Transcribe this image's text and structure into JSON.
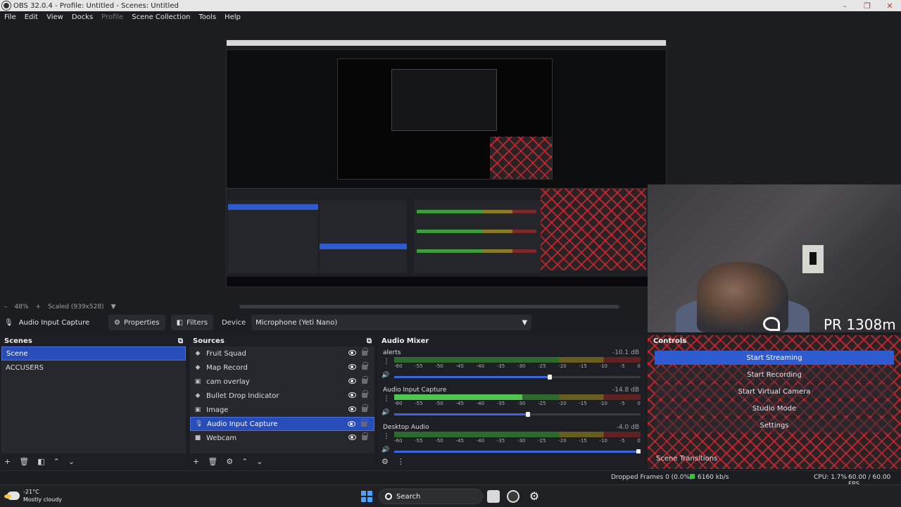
{
  "window": {
    "title": "OBS 32.0.4 - Profile: Untitled - Scenes: Untitled",
    "controls": [
      "–",
      "❐",
      "✕"
    ]
  },
  "menu": {
    "items": [
      "File",
      "Edit",
      "View",
      "Docks",
      "Profile",
      "Scene Collection",
      "Tools",
      "Help"
    ]
  },
  "preview": {
    "zoom": "48%",
    "scaled": "Scaled (939x528)",
    "overlay_text": "PR 1308m"
  },
  "context": {
    "source_name": "Audio Input Capture",
    "properties_label": "Properties",
    "filters_label": "Filters",
    "device_label": "Device",
    "device_value": "Microphone (Yeti Nano)"
  },
  "scenes": {
    "title": "Scenes",
    "items": [
      {
        "label": "Scene",
        "selected": true
      },
      {
        "label": "ACCUSERS",
        "selected": false
      }
    ]
  },
  "sources": {
    "title": "Sources",
    "items": [
      {
        "label": "Fruit Squad",
        "icon": "game-capture-icon"
      },
      {
        "label": "Map Record",
        "icon": "game-capture-icon"
      },
      {
        "label": "cam overlay",
        "icon": "image-icon"
      },
      {
        "label": "Bullet Drop Indicator",
        "icon": "game-capture-icon"
      },
      {
        "label": "Image",
        "icon": "image-icon"
      },
      {
        "label": "Audio Input Capture",
        "icon": "microphone-icon",
        "selected": true
      },
      {
        "label": "Webcam",
        "icon": "camera-icon"
      }
    ]
  },
  "mixer": {
    "title": "Audio Mixer",
    "ticks": [
      "-60",
      "-55",
      "-50",
      "-45",
      "-40",
      "-35",
      "-30",
      "-25",
      "-20",
      "-15",
      "-10",
      "-5",
      "0"
    ],
    "channels": [
      {
        "name": "alerts",
        "db": "-10.1 dB",
        "level": 0.0,
        "volume": 0.64
      },
      {
        "name": "Audio Input Capture",
        "db": "-14.8 dB",
        "level": 0.52,
        "volume": 0.55
      },
      {
        "name": "Desktop Audio",
        "db": "-4.0 dB",
        "level": 0.0,
        "volume": 1.0
      }
    ]
  },
  "controls": {
    "title": "Controls",
    "buttons": [
      "Start Streaming",
      "Start Recording",
      "Start Virtual Camera",
      "Studio Mode",
      "Settings"
    ],
    "scene_transitions": "Scene Transitions"
  },
  "status": {
    "dropped_frames": "Dropped Frames 0 (0.0%)",
    "bitrate": "6160 kb/s",
    "cpu": "CPU: 1.7%",
    "fps": "60.00 / 60.00 FPS"
  },
  "taskbar": {
    "temperature": "-21°C",
    "weather": "Mostly cloudy",
    "search_label": "Search"
  },
  "colors": {
    "accent": "#2f5bd1",
    "background": "#1c1d21",
    "dock": "#27282e",
    "meter_green": "#4ec54e"
  }
}
